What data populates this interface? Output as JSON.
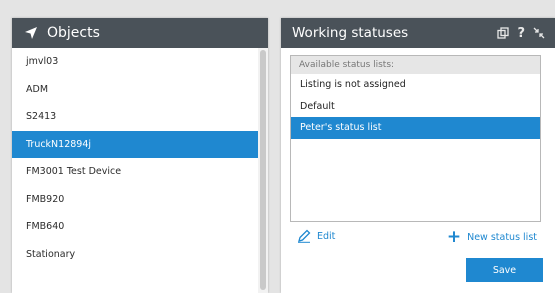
{
  "objects_panel": {
    "title": "Objects",
    "items": [
      {
        "label": "jmvl03",
        "selected": false
      },
      {
        "label": "ADM",
        "selected": false
      },
      {
        "label": "S2413",
        "selected": false
      },
      {
        "label": "TruckN12894j",
        "selected": true
      },
      {
        "label": "FM3001 Test Device",
        "selected": false
      },
      {
        "label": "FMB920",
        "selected": false
      },
      {
        "label": "FMB640",
        "selected": false
      },
      {
        "label": "Stationary",
        "selected": false
      }
    ]
  },
  "status_panel": {
    "title": "Working statuses",
    "header_icons": [
      "copy-icon",
      "help-icon",
      "collapse-icon"
    ],
    "help_glyph": "?",
    "available_label": "Available status lists:",
    "lists": [
      {
        "label": "Listing is not assigned",
        "selected": false
      },
      {
        "label": "Default",
        "selected": false
      },
      {
        "label": "Peter's status list",
        "selected": true
      }
    ],
    "edit_label": "Edit",
    "new_list_label": "New status list",
    "save_label": "Save"
  },
  "colors": {
    "accent": "#1f88d0",
    "header_bg": "#4a5259",
    "page_bg": "#e4e4e4"
  }
}
